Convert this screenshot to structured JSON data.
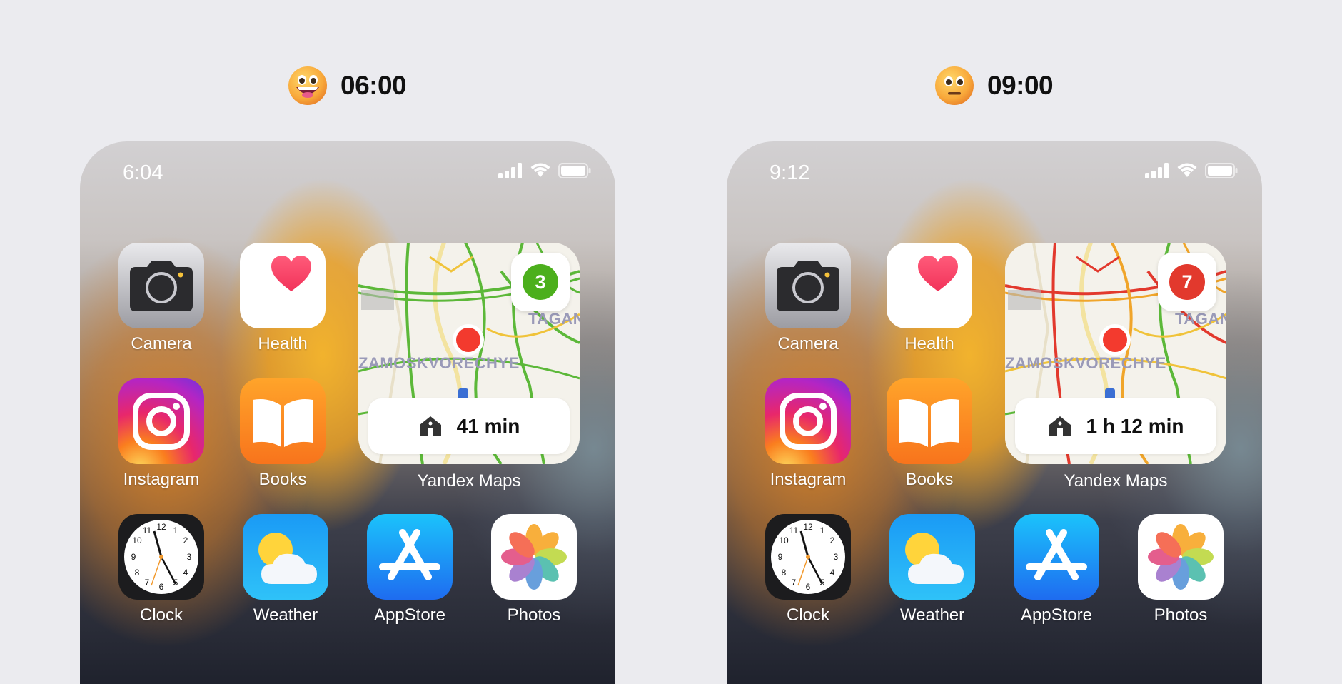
{
  "panels": [
    {
      "time_label": "06:00",
      "emoji": "grinning-face-emoji",
      "status_time": "6:04",
      "traffic_score": "3",
      "traffic_color": "#4caf1c",
      "route_time": "41 min",
      "apps_row1": [
        {
          "label": "Camera",
          "icon": "camera-icon"
        },
        {
          "label": "Health",
          "icon": "heart-icon"
        }
      ],
      "apps_row2": [
        {
          "label": "Instagram",
          "icon": "instagram-icon"
        },
        {
          "label": "Books",
          "icon": "book-icon"
        }
      ],
      "apps_row3": [
        {
          "label": "Clock",
          "icon": "clock-icon"
        },
        {
          "label": "Weather",
          "icon": "weather-icon"
        },
        {
          "label": "AppStore",
          "icon": "appstore-icon"
        },
        {
          "label": "Photos",
          "icon": "photos-icon"
        }
      ],
      "widget_label": "Yandex Maps",
      "map_labels": [
        "ZAMOSKVORECHYE",
        "TAGAN"
      ]
    },
    {
      "time_label": "09:00",
      "emoji": "neutral-face-emoji",
      "status_time": "9:12",
      "traffic_score": "7",
      "traffic_color": "#e2392d",
      "route_time": "1 h 12 min",
      "apps_row1": [
        {
          "label": "Camera",
          "icon": "camera-icon"
        },
        {
          "label": "Health",
          "icon": "heart-icon"
        }
      ],
      "apps_row2": [
        {
          "label": "Instagram",
          "icon": "instagram-icon"
        },
        {
          "label": "Books",
          "icon": "book-icon"
        }
      ],
      "apps_row3": [
        {
          "label": "Clock",
          "icon": "clock-icon"
        },
        {
          "label": "Weather",
          "icon": "weather-icon"
        },
        {
          "label": "AppStore",
          "icon": "appstore-icon"
        },
        {
          "label": "Photos",
          "icon": "photos-icon"
        }
      ],
      "widget_label": "Yandex Maps",
      "map_labels": [
        "ZAMOSKVORECHYE",
        "TAGAN"
      ]
    }
  ]
}
